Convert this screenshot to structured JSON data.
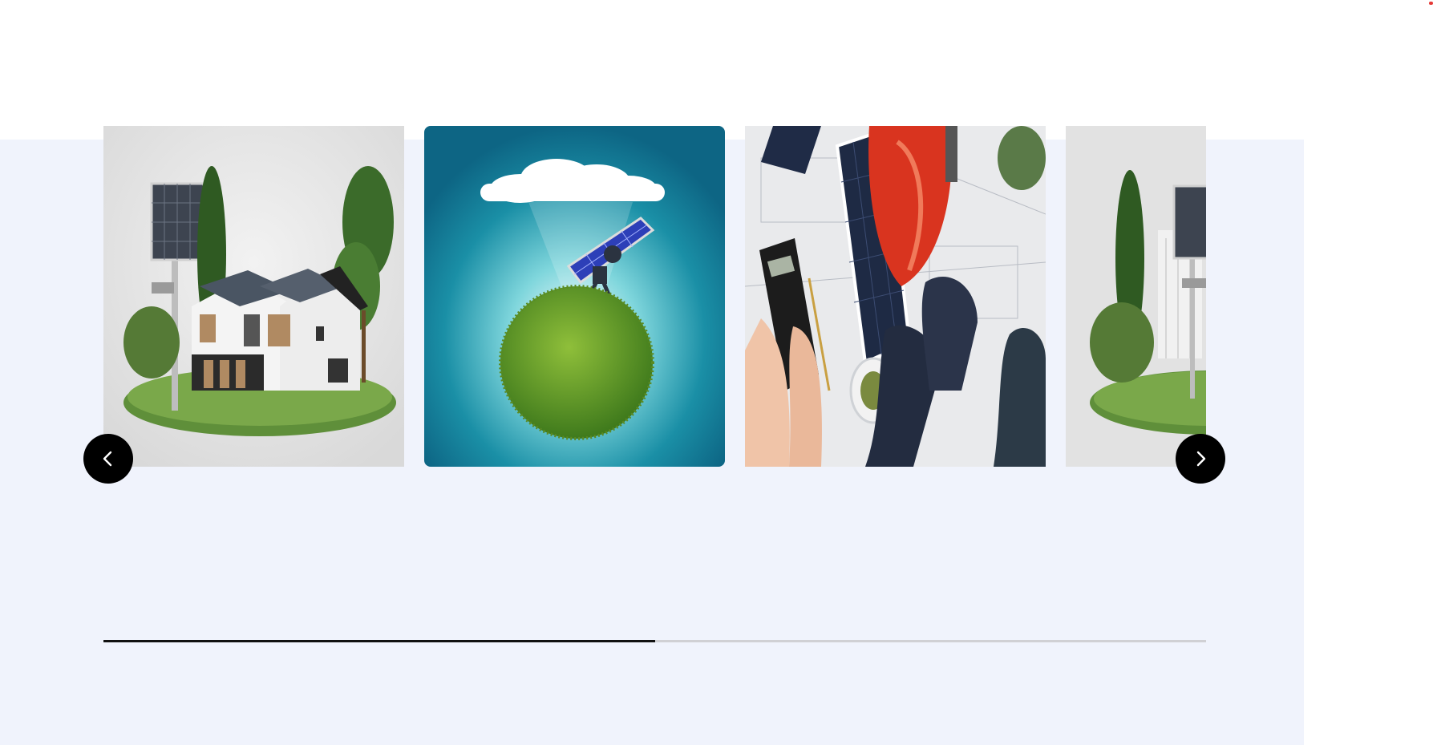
{
  "colors": {
    "section_background": "#f0f3fc",
    "nav_button": "#000000",
    "progress_fill": "#111111",
    "progress_track": "#d0d0d4"
  },
  "carousel": {
    "slides": [
      {
        "image": "house-with-solar-panels-on-lawn"
      },
      {
        "image": "robot-carrying-solar-panel-on-grass-globe"
      },
      {
        "image": "solar-panels-calculator-hard-hat-blueprints"
      },
      {
        "image": "house-with-solar-panels-on-lawn-partial"
      }
    ],
    "prev_icon": "chevron-left-icon",
    "next_icon": "chevron-right-icon",
    "progress": 0.5
  }
}
